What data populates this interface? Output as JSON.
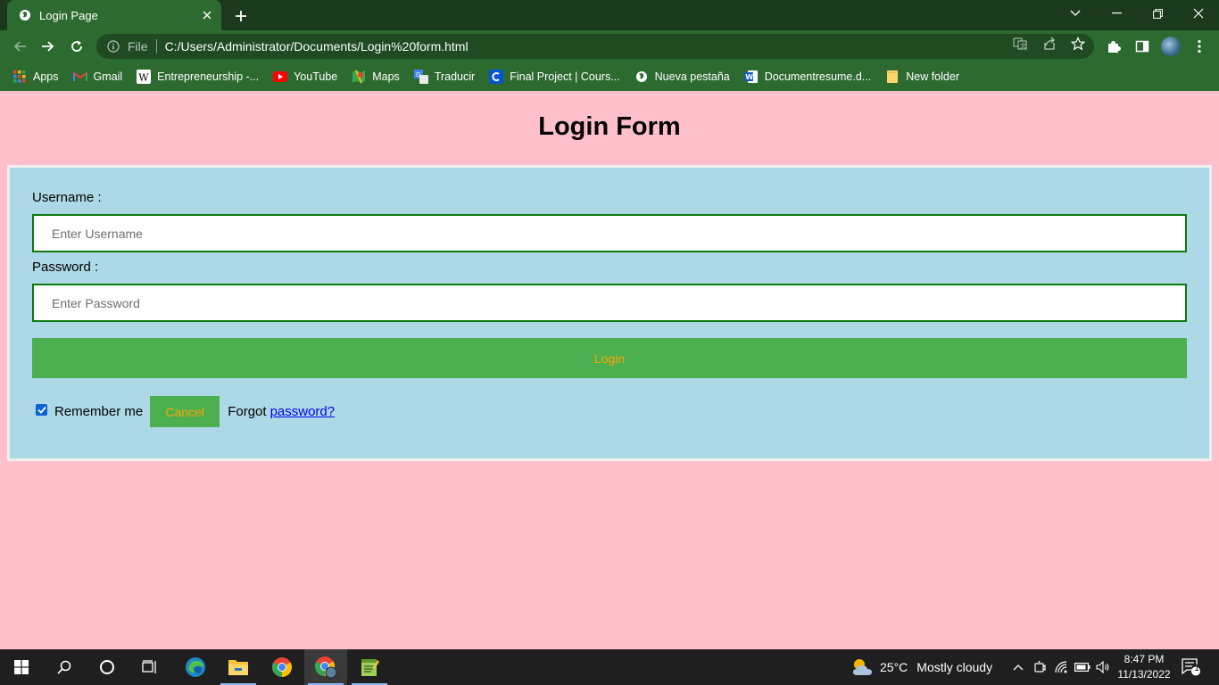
{
  "browser": {
    "tab_title": "Login Page",
    "address": {
      "scheme": "File",
      "url": "C:/Users/Administrator/Documents/Login%20form.html"
    },
    "bookmarks": [
      {
        "label": "Apps",
        "icon": "apps-grid-icon"
      },
      {
        "label": "Gmail",
        "icon": "gmail-icon"
      },
      {
        "label": "Entrepreneurship -...",
        "icon": "wikipedia-icon"
      },
      {
        "label": "YouTube",
        "icon": "youtube-icon"
      },
      {
        "label": "Maps",
        "icon": "maps-icon"
      },
      {
        "label": "Traducir",
        "icon": "translate-icon"
      },
      {
        "label": "Final Project | Cours...",
        "icon": "coursera-icon"
      },
      {
        "label": "Nueva pestaña",
        "icon": "globe-icon"
      },
      {
        "label": "Documentresume.d...",
        "icon": "word-icon"
      },
      {
        "label": "New folder",
        "icon": "folder-icon"
      }
    ]
  },
  "page": {
    "title": "Login Form",
    "username": {
      "label": "Username :",
      "placeholder": "Enter Username"
    },
    "password": {
      "label": "Password :",
      "placeholder": "Enter Password"
    },
    "login_button": "Login",
    "remember_label": "Remember me",
    "remember_checked": true,
    "cancel_button": "Cancel",
    "forgot_prefix": "Forgot",
    "forgot_link": "password?"
  },
  "taskbar": {
    "weather": {
      "temperature": "25°C",
      "condition": "Mostly cloudy"
    },
    "time": "8:47 PM",
    "date": "11/13/2022",
    "notification_count": "1"
  },
  "colors": {
    "page_background": "#ffc0cb",
    "form_background": "#add8e6",
    "button_background": "#4caf50",
    "button_text": "#ffa500",
    "input_border": "#0a7a0a",
    "browser_chrome": "#2d6a30"
  }
}
